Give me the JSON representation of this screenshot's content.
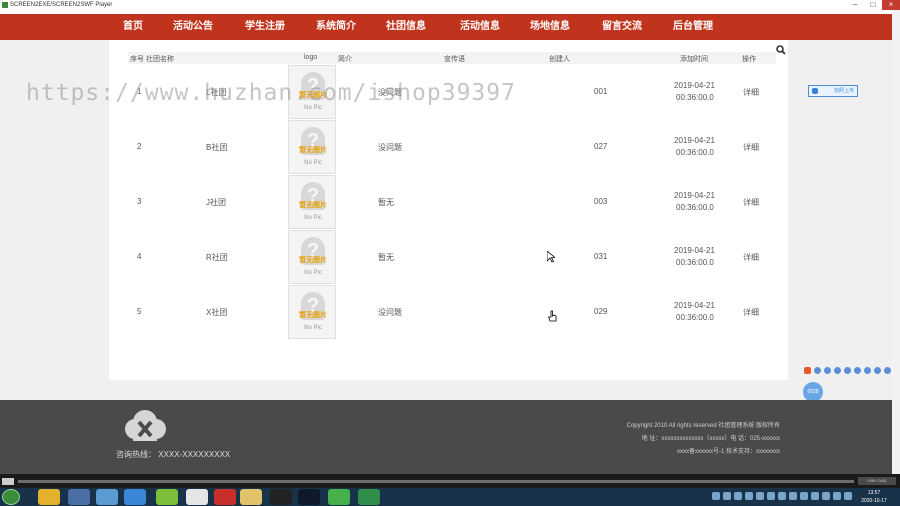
{
  "window": {
    "title": "SCREEN2EXE/SCREEN2SWF Player",
    "min": "–",
    "max": "□",
    "close": "×"
  },
  "nav": [
    {
      "label": "首页",
      "x": 0
    },
    {
      "label": "活动公告",
      "x": 1
    },
    {
      "label": "学生注册",
      "x": 2
    },
    {
      "label": "系统简介",
      "x": 3
    },
    {
      "label": "社团信息",
      "x": 4
    },
    {
      "label": "活动信息",
      "x": 5
    },
    {
      "label": "场地信息",
      "x": 6
    },
    {
      "label": "留言交流",
      "x": 7
    },
    {
      "label": "后台管理",
      "x": 8
    }
  ],
  "table": {
    "headers": {
      "seq": "序号",
      "name": "社团名称",
      "logo": "logo",
      "intro": "简介",
      "slogan": "宣传语",
      "creator": "创建人",
      "added": "添加时间",
      "op": "操作"
    },
    "no_image_label": "暂无图片",
    "no_pic_label": "No Pic",
    "rows": [
      {
        "seq": "1",
        "name": "L社团",
        "intro": "没问题",
        "creator": "001",
        "date": "2019-04-21",
        "time": "00:36:00.0",
        "op": "详细"
      },
      {
        "seq": "2",
        "name": "B社团",
        "intro": "没问题",
        "creator": "027",
        "date": "2019-04-21",
        "time": "00:36:00.0",
        "op": "详细"
      },
      {
        "seq": "3",
        "name": "J社团",
        "intro": "暂无",
        "creator": "003",
        "date": "2019-04-21",
        "time": "00:36:00.0",
        "op": "详细"
      },
      {
        "seq": "4",
        "name": "R社团",
        "intro": "暂无",
        "creator": "031",
        "date": "2019-04-21",
        "time": "00:36:00.0",
        "op": "详细"
      },
      {
        "seq": "5",
        "name": "X社团",
        "intro": "没问题",
        "creator": "029",
        "date": "2019-04-21",
        "time": "00:36:00.0",
        "op": "详细"
      }
    ]
  },
  "watermark": "https://www.huzhan.com/ishop39397",
  "side_button": "拍照上传",
  "bubble": "0928",
  "footer": {
    "hotline": "咨询热线： XXXX-XXXXXXXXX",
    "copyright": "Copyright 2010 All rights reserved 社团管理系统 版权所有",
    "address": "地   址：xxxxxxxxxxxxxx（xxxxx）电   话：025-xxxxxx",
    "icp": "xxxx备xxxxxx号-1 技术支持：xxxxxxxx"
  },
  "player": {
    "time": "0:09 / 0:41"
  },
  "clock": {
    "time": "13:57",
    "date": "2020-10-17"
  },
  "colors": {
    "nav": "#c0341d",
    "footer": "#4a4a4a",
    "accent": "#4a90d9"
  }
}
